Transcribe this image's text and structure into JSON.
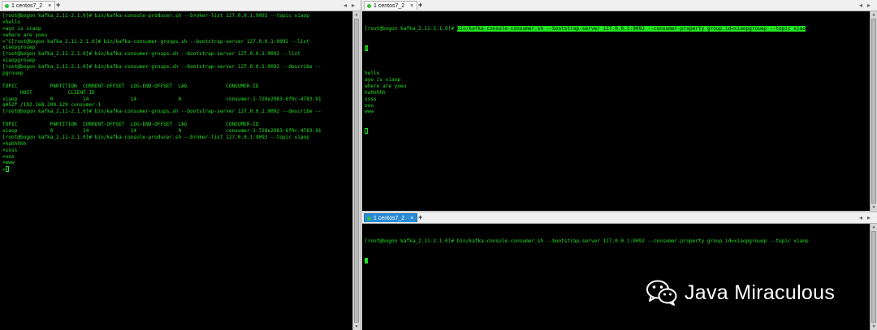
{
  "window_left": {
    "tab_label": "1 centos7_2",
    "lines": [
      "[root@bogon kafka_2.11-2.1.0]# bin/kafka-console-producer.sh --broker-list 127.0.0.1:9092 --topic xiaop",
      ">hello",
      ">ayo is xiaop",
      ">where are yoeu",
      ">^C[root@bogon kafka_2.11-2.1.0]# bin/kafka-consumer-groups.sh --bootstrap-server 127.0.0.1:9092 --list",
      "xiaopgrouep",
      "[root@bogon kafka_2.11-2.1.0]# bin/kafka-consumer-groups.sh --bootstrap-server 127.0.0.1:9092 --list",
      "xiaopgrouep",
      "[root@bogon kafka_2.11-2.1.0]# bin/kafka-consumer-groups.sh --bootstrap-server 127.0.0.1:9092 --describe --",
      "pgrouep",
      "",
      "TOPIC           PARTITION  CURRENT-OFFSET  LOG-END-OFFSET  LAG             CONSUMER-ID",
      "      HOST            CLIENT-ID",
      "xiaop           0          14              14              0               consumer-1-728e2083-6f0c-4783-91",
      "a052f /192.168.209.129 consumer-1",
      "[root@bogon kafka_2.11-2.1.0]# bin/kafka-consumer-groups.sh --bootstrap-server 127.0.0.1:9092 --describe --",
      "",
      "TOPIC           PARTITION  CURRENT-OFFSET  LOG-END-OFFSET  LAG             CONSUMER-ID",
      "xiaop           0          14              14              0               consumer-1-728e2083-6f0c-4783-91",
      "[root@bogon kafka_2.11-2.1.0]# bin/kafka-console-producer.sh --broker-list 127.0.0.1:9092 --topic xiaop",
      ">hahhhhh",
      ">ssss",
      ">ooo",
      ">www",
      ">"
    ]
  },
  "window_right_top": {
    "tab_label": "1 centos7_2",
    "prompt": "[root@bogon kafka_2.11-2.1.0]# ",
    "command": "bin/kafka-console-consumer.sh --bootstrap-server 127.0.0.1:9092 --consumer-property group.id=xiaopgrouep --topic xiao",
    "command_wrap": "p",
    "lines": [
      "",
      "hello",
      "ayo is xiaop",
      "where are yoeu",
      "hahhhhh",
      "ssss",
      "ooo",
      "www"
    ]
  },
  "window_right_bottom": {
    "tab_label": "1 centos7_2",
    "lines": [
      "[root@bogon kafka_2.11-2.1.0]# bin/kafka-console-consumer.sh --bootstrap-server 127.0.0.1:9092 --consumer-property group.id=xiaopgrouep --topic xiaop"
    ]
  },
  "watermark": {
    "text": "Java Miraculous",
    "icon": "wechat-icon"
  },
  "colors": {
    "terminal_bg": "#000000",
    "terminal_fg": "#23e023",
    "active_tab": "#2a8bd6"
  }
}
